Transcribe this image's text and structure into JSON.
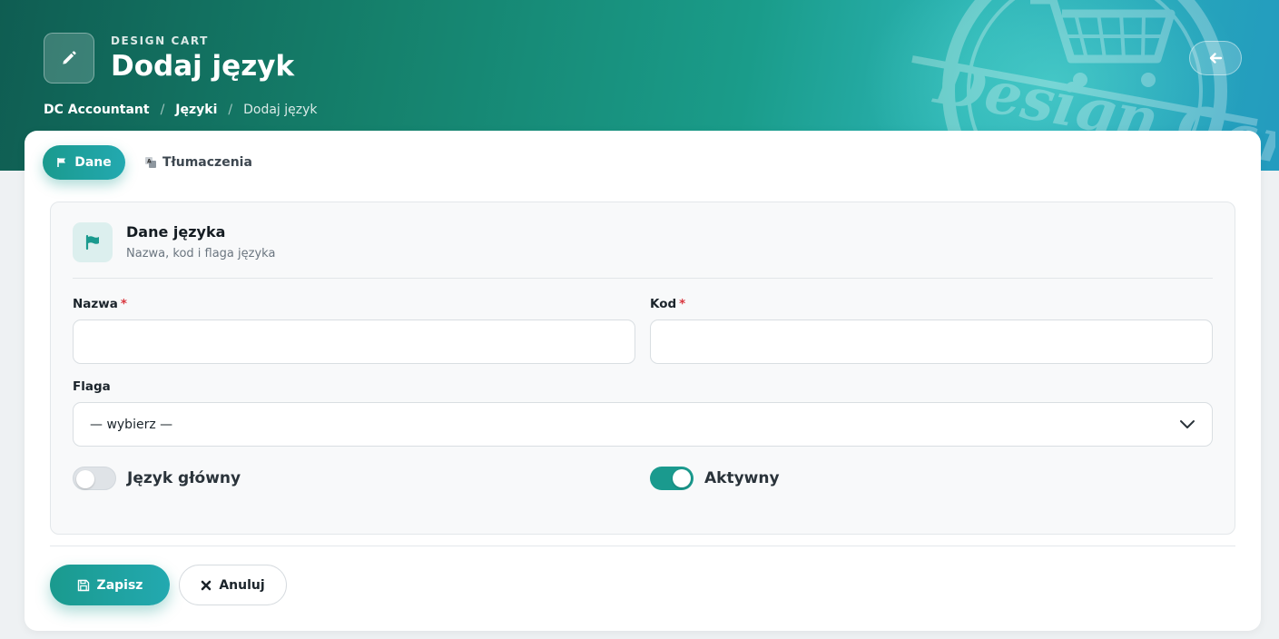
{
  "header": {
    "kicker": "DESIGN CART",
    "title": "Dodaj język",
    "watermark_text": "Design Cart",
    "breadcrumb": [
      "DC Accountant",
      "Języki",
      "Dodaj język"
    ],
    "breadcrumb_separator": "/"
  },
  "tabs": [
    {
      "label": "Dane",
      "active": true,
      "icon": "flag-icon"
    },
    {
      "label": "Tłumaczenia",
      "active": false,
      "icon": "translate-icon"
    }
  ],
  "section": {
    "title": "Dane języka",
    "subtitle": "Nazwa, kod i flaga języka"
  },
  "form": {
    "name_label": "Nazwa",
    "name_value": "",
    "code_label": "Kod",
    "code_value": "",
    "required_mark": "*",
    "flag_label": "Flaga",
    "flag_selected": "— wybierz —",
    "main_language_label": "Język główny",
    "main_language_on": false,
    "active_label": "Aktywny",
    "active_on": true
  },
  "actions": {
    "save_label": "Zapisz",
    "cancel_label": "Anuluj"
  },
  "colors": {
    "accent": "#1a9a8e",
    "required": "#d9363e"
  }
}
